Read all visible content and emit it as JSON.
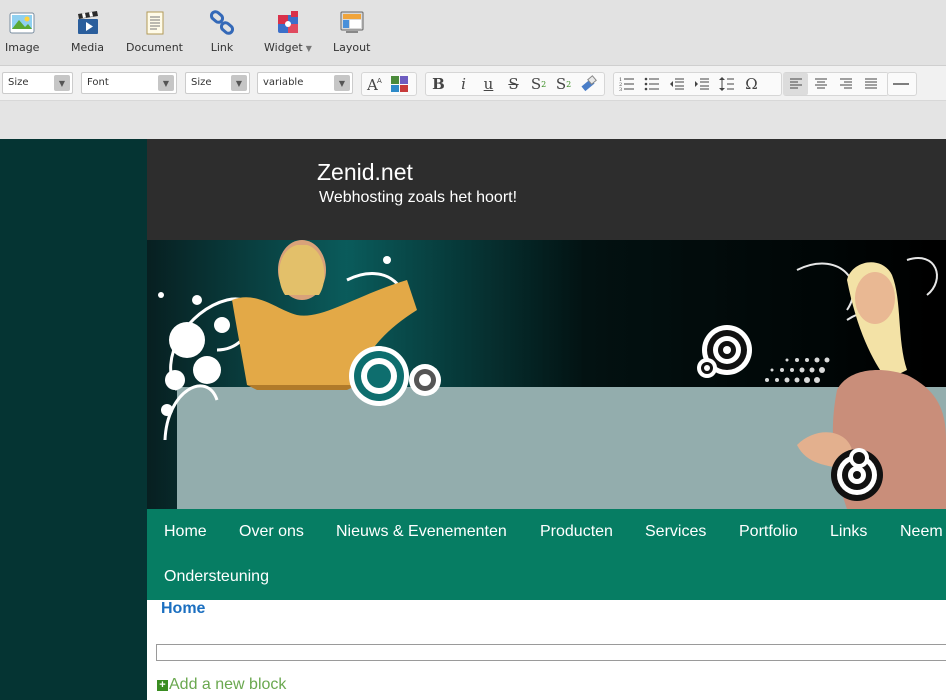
{
  "toolbar": {
    "image": "Image",
    "media": "Media",
    "document": "Document",
    "link": "Link",
    "widget": "Widget",
    "layout": "Layout"
  },
  "format_bar": {
    "style_select": "Size",
    "font_select": "Font",
    "size_select": "Size",
    "variable_select": "variable",
    "buttons": [
      "font-color",
      "background-color",
      "bold",
      "italic",
      "underline",
      "strikethrough",
      "superscript",
      "subscript",
      "clear-format",
      "ordered-list",
      "unordered-list",
      "outdent",
      "indent",
      "line-height",
      "special-character",
      "align-left",
      "align-center",
      "align-right",
      "justify",
      "horizontal-rule"
    ],
    "bold_glyph": "B",
    "italic_glyph": "i",
    "underline_glyph": "u",
    "strike_glyph": "S",
    "omega_glyph": "Ω"
  },
  "site": {
    "title": "Zenid.net",
    "tagline": "Webhosting zoals het hoort!"
  },
  "nav": {
    "items": [
      "Home",
      "Over ons",
      "Nieuws & Evenementen",
      "Producten",
      "Services",
      "Portfolio",
      "Links",
      "Neem",
      "Ondersteuning"
    ]
  },
  "content": {
    "breadcrumb": "Home",
    "add_block": "Add a new block"
  },
  "colors": {
    "nav_bg": "#067d63",
    "header_bg": "#2d2d2d",
    "left_strip": "#053433",
    "breadcrumb": "#1b6fc0",
    "add_block": "#6aa84f"
  }
}
